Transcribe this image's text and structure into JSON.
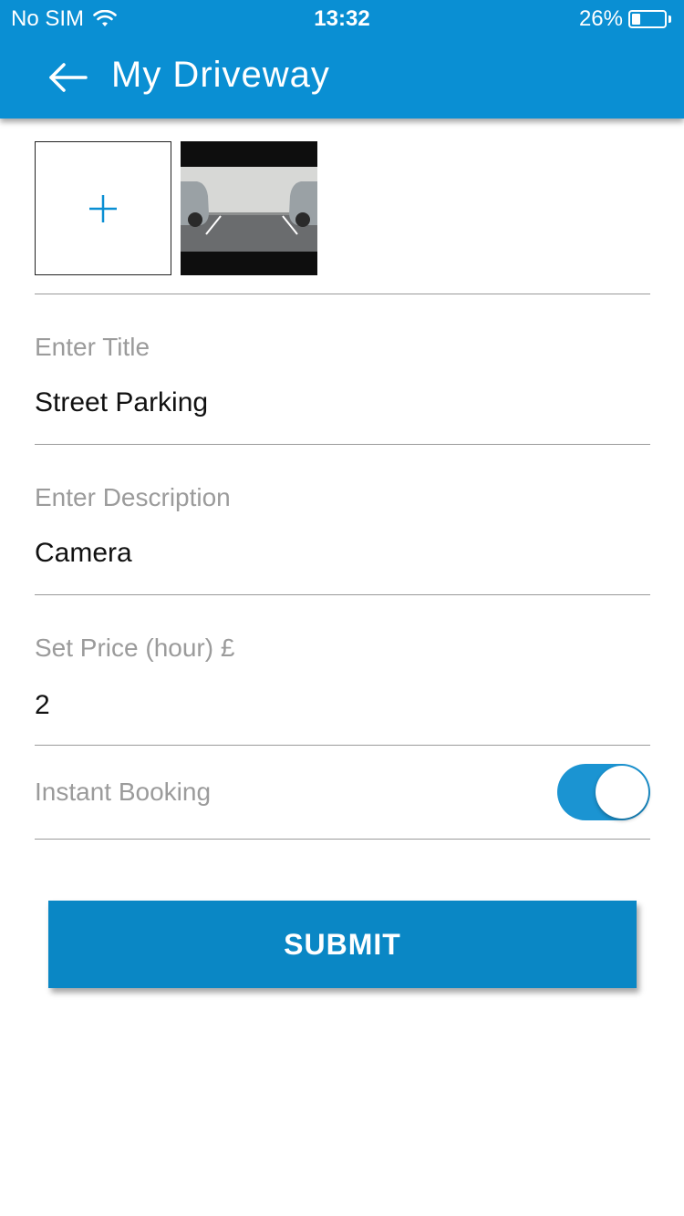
{
  "status_bar": {
    "carrier": "No SIM",
    "time": "13:32",
    "battery_percent": "26%",
    "battery_level": 0.26
  },
  "header": {
    "title": "My Driveway",
    "back_icon": "arrow-left-icon",
    "background_color": "#0a8fd3"
  },
  "photos": {
    "add_icon": "plus-icon",
    "thumbnail_description": "parking-space-photo"
  },
  "form": {
    "title_label": "Enter Title",
    "title_value": "Street Parking",
    "description_label": "Enter Description",
    "description_value": "Camera",
    "price_label": "Set Price (hour) £",
    "price_value": "2",
    "instant_booking_label": "Instant Booking",
    "instant_booking_enabled": true
  },
  "actions": {
    "submit_label": "SUBMIT",
    "submit_color": "#0a87c5"
  }
}
